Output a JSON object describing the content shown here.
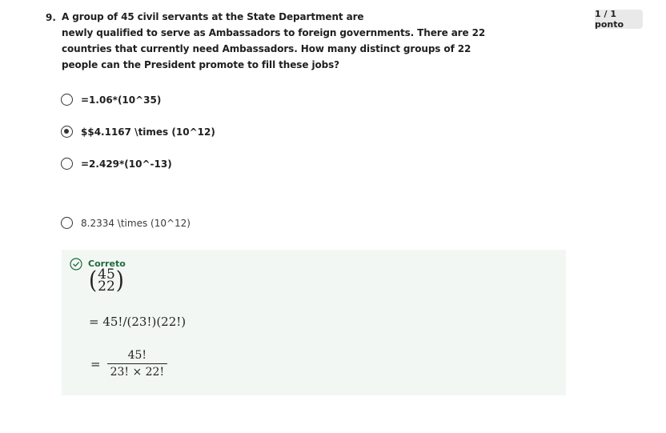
{
  "question": {
    "number": "9.",
    "lines": [
      "A group of 45 civil servants at the State Department are",
      "newly qualified to serve as Ambassadors to foreign governments. There are 22",
      "countries that currently need Ambassadors. How many distinct groups of 22",
      "people can the President promote to fill these jobs?"
    ]
  },
  "score": "1 / 1 ponto",
  "options": [
    {
      "label": "=1.06*(10^35)",
      "selected": false
    },
    {
      "label": "$$4.1167 \\times (10^12)",
      "selected": true
    },
    {
      "label": "=2.429*(10^-13)",
      "selected": false
    },
    {
      "label": "8.2334 \\times (10^12)",
      "selected": false
    }
  ],
  "feedback": {
    "status": "Correto",
    "icon": "check-circle-icon",
    "binom_top": "45",
    "binom_bottom": "22",
    "line1": "= 45!/(23!)(22!)",
    "equals": "=",
    "frac_numerator": "45!",
    "frac_denominator": "23! × 22!"
  },
  "colors": {
    "feedback_bg": "#f2f7f4",
    "correct_green": "#1f6b3a",
    "badge_bg": "#e9e9e9"
  }
}
